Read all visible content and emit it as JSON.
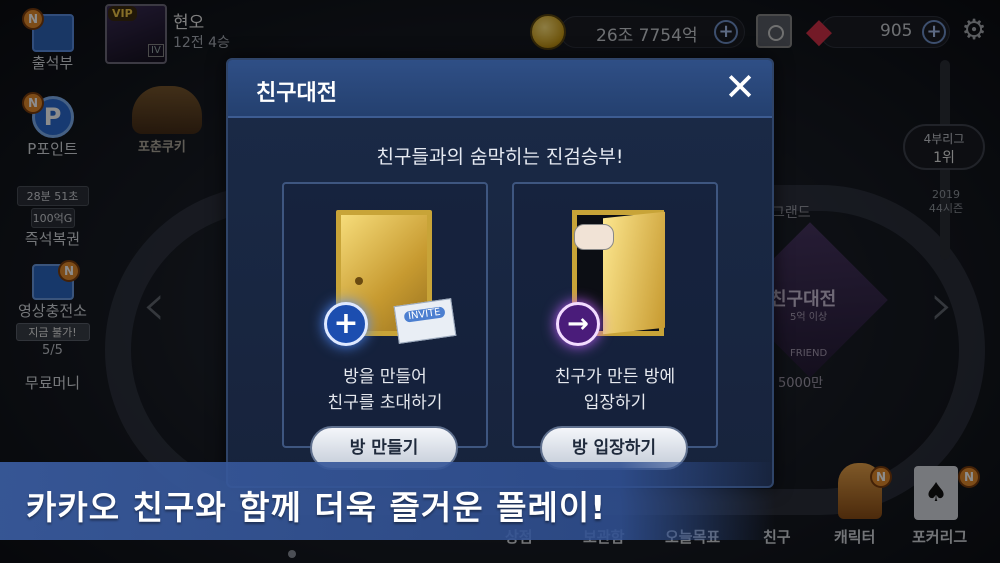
{
  "user": {
    "vip": "VIP",
    "name": "현오",
    "record": "12전 4승",
    "level": "IV"
  },
  "currency": {
    "coins": "26조 7754억",
    "gems": "905"
  },
  "sidebar": {
    "attendance": {
      "label": "출석부",
      "badge": "N"
    },
    "points": {
      "label": "P포인트",
      "badge": "N"
    },
    "instant": {
      "timer": "28분 51초",
      "amount": "100억G",
      "label": "즉석복권"
    },
    "video": {
      "label": "영상충전소",
      "badge": "N",
      "status": "지금 불가!",
      "count": "5/5"
    },
    "free": {
      "label": "무료머니"
    }
  },
  "background": {
    "cookie_label": "포춘쿠키",
    "league": {
      "name": "4부리그",
      "rank": "1위",
      "season_year": "2019",
      "season": "44시즌"
    },
    "grand_label": "그랜드",
    "chip": {
      "title": "친구대전",
      "sub": "5억 이상",
      "friend": "FRIEND",
      "amount": "5000만"
    },
    "arrow_left": "‹",
    "arrow_right": "›"
  },
  "modal": {
    "title": "친구대전",
    "subtitle": "친구들과의 숨막히는 진검승부!",
    "create": {
      "line1": "방을 만들어",
      "line2": "친구를 초대하기",
      "button": "방 만들기",
      "invite": "INVITE"
    },
    "join": {
      "line1": "친구가 만든 방에",
      "line2": "입장하기",
      "button": "방 입장하기"
    }
  },
  "bottom_nav": [
    "상점",
    "보관함",
    "오늘목표",
    "친구",
    "캐릭터",
    "포커리그"
  ],
  "banner": {
    "text": "카카오 친구와 함께 더욱 즐거운 플레이!"
  },
  "colors": {
    "modal_header": "#2f4f86",
    "banner": "#3a5ca0",
    "badge": "#e48a2c",
    "coin": "#e0b030",
    "gem": "#d23148"
  }
}
